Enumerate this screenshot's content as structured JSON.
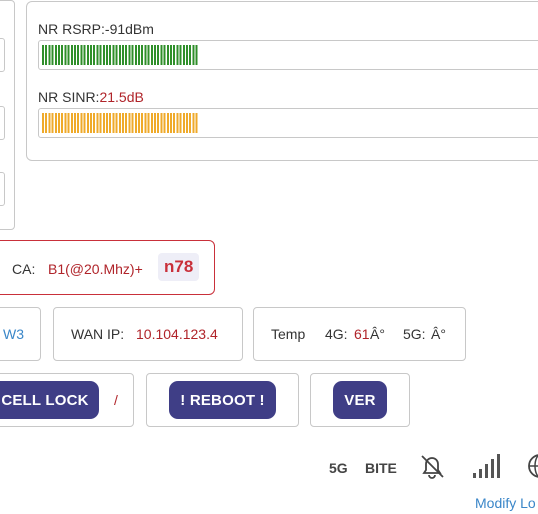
{
  "signal": {
    "nr_rsrp": {
      "label": "NR RSRP:",
      "value": "-91dBm",
      "level": 0.305
    },
    "nr_sinr": {
      "label": "NR SINR:",
      "value": "21.5dB",
      "level": 0.305
    },
    "colors": {
      "rsrp_bar": "#2f8f2a",
      "sinr_bar": "#efaa2a",
      "value_red": "#b0242a"
    }
  },
  "ca": {
    "label": "CA:",
    "value": "B1(@20.Mhz)+",
    "band": "n78"
  },
  "info_row": {
    "left_partial": "W3",
    "wan_ip": {
      "label": "WAN IP:",
      "value": "10.104.123.4"
    },
    "temp": {
      "label": "Temp",
      "g4_label": "4G:",
      "g4_value": "61",
      "g4_unit": "Â°",
      "g5_label": "5G:",
      "g5_value": "Â°"
    }
  },
  "actions": {
    "cell_lock": "CELL LOCK",
    "separator": "/",
    "reboot": "! REBOOT !",
    "ver": "VER"
  },
  "statusbar": {
    "net_5g": "5G",
    "operator": "BITE",
    "icons": [
      "notifications-off-icon",
      "signal-bars-icon",
      "globe-icon"
    ],
    "modify_link": "Modify Lo"
  }
}
